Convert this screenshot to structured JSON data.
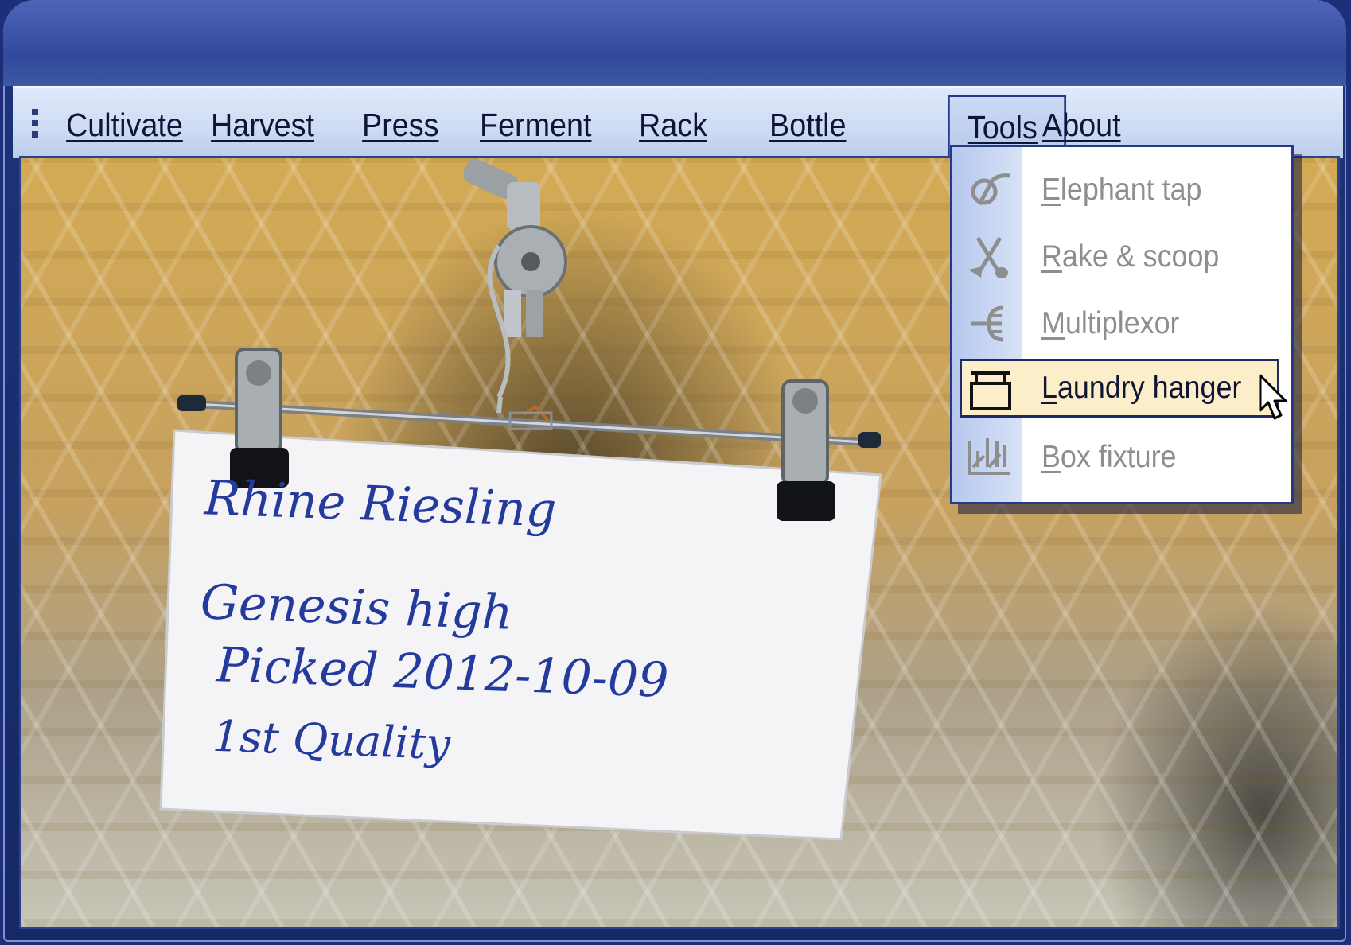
{
  "menubar": {
    "items": [
      {
        "label": "Cultivate"
      },
      {
        "label": "Harvest"
      },
      {
        "label": "Press"
      },
      {
        "label": "Ferment"
      },
      {
        "label": "Rack"
      },
      {
        "label": "Bottle"
      },
      {
        "label": "Tools"
      },
      {
        "label": "About"
      }
    ],
    "open_menu": "Tools"
  },
  "tools_menu": {
    "items": [
      {
        "label": "Elephant tap",
        "icon": "elephant-tap-icon",
        "enabled": false
      },
      {
        "label": "Rake & scoop",
        "icon": "rake-scoop-icon",
        "enabled": false
      },
      {
        "label": "Multiplexor",
        "icon": "multiplexor-icon",
        "enabled": false
      },
      {
        "label": "Laundry hanger",
        "icon": "laundry-hanger-icon",
        "enabled": true,
        "hovered": true
      },
      {
        "label": "Box fixture",
        "icon": "box-fixture-icon",
        "enabled": false
      }
    ]
  },
  "photo_card": {
    "lines": [
      "Rhine Riesling",
      "Genesis high",
      "Picked 2012-10-09",
      "1st Quality"
    ]
  },
  "colors": {
    "title_bar": "#3a52a6",
    "menu_bar": "#cfdcf4",
    "selected_item_bg": "#fdeeca",
    "disabled_text": "#8e8e8e",
    "handwriting": "#243a9c"
  }
}
